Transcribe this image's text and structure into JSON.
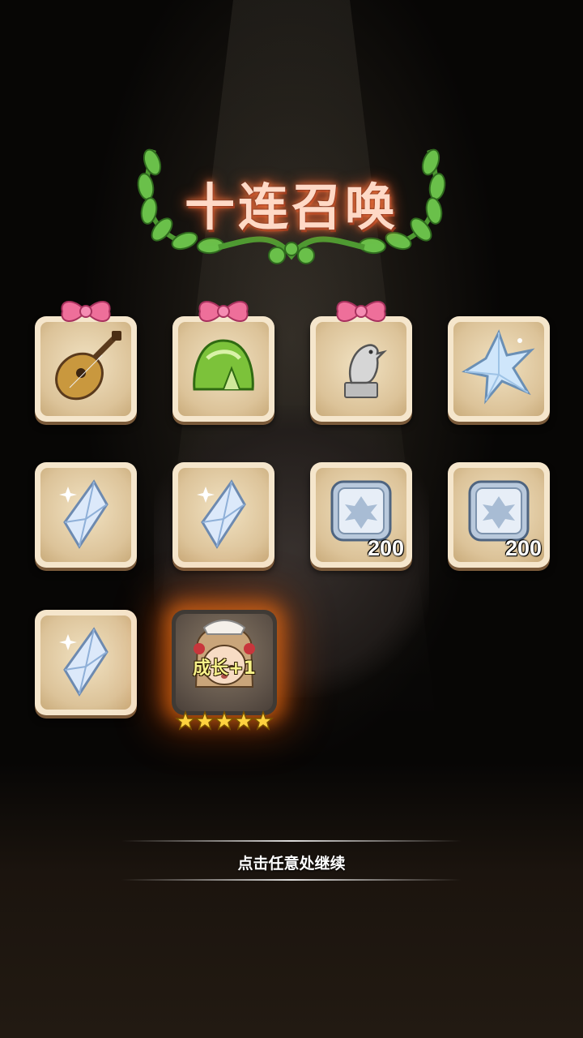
{
  "screen": {
    "title": "十连召唤",
    "continue_hint": "点击任意处继续"
  },
  "rewards": [
    {
      "item": "lute",
      "icon": "lute-icon",
      "has_bow": true,
      "quantity": ""
    },
    {
      "item": "green-leaf-dumpling",
      "icon": "leaf-dumpling-icon",
      "has_bow": true,
      "quantity": ""
    },
    {
      "item": "bird-statue",
      "icon": "bird-statue-icon",
      "has_bow": true,
      "quantity": ""
    },
    {
      "item": "star-crystal",
      "icon": "star-crystal-icon",
      "has_bow": false,
      "quantity": ""
    },
    {
      "item": "crystal-shard",
      "icon": "crystal-shard-icon",
      "has_bow": false,
      "quantity": ""
    },
    {
      "item": "crystal-shard",
      "icon": "crystal-shard-icon",
      "has_bow": false,
      "quantity": ""
    },
    {
      "item": "silver-token",
      "icon": "silver-token-icon",
      "has_bow": false,
      "quantity": "200"
    },
    {
      "item": "silver-token",
      "icon": "silver-token-icon",
      "has_bow": false,
      "quantity": "200"
    },
    {
      "item": "crystal-shard",
      "icon": "crystal-shard-icon",
      "has_bow": false,
      "quantity": ""
    }
  ],
  "hero_reward": {
    "label": "成长+1",
    "stars": 5,
    "icon": "maid-hero-portrait"
  },
  "colors": {
    "title_glow": "#ff7a3a",
    "card_frame": "#f5e6cc",
    "bow_pink": "#ee6f9a",
    "laurel_green": "#6ac04a",
    "star_yellow": "#ffd23f",
    "hero_glow": "#ff7a14"
  }
}
